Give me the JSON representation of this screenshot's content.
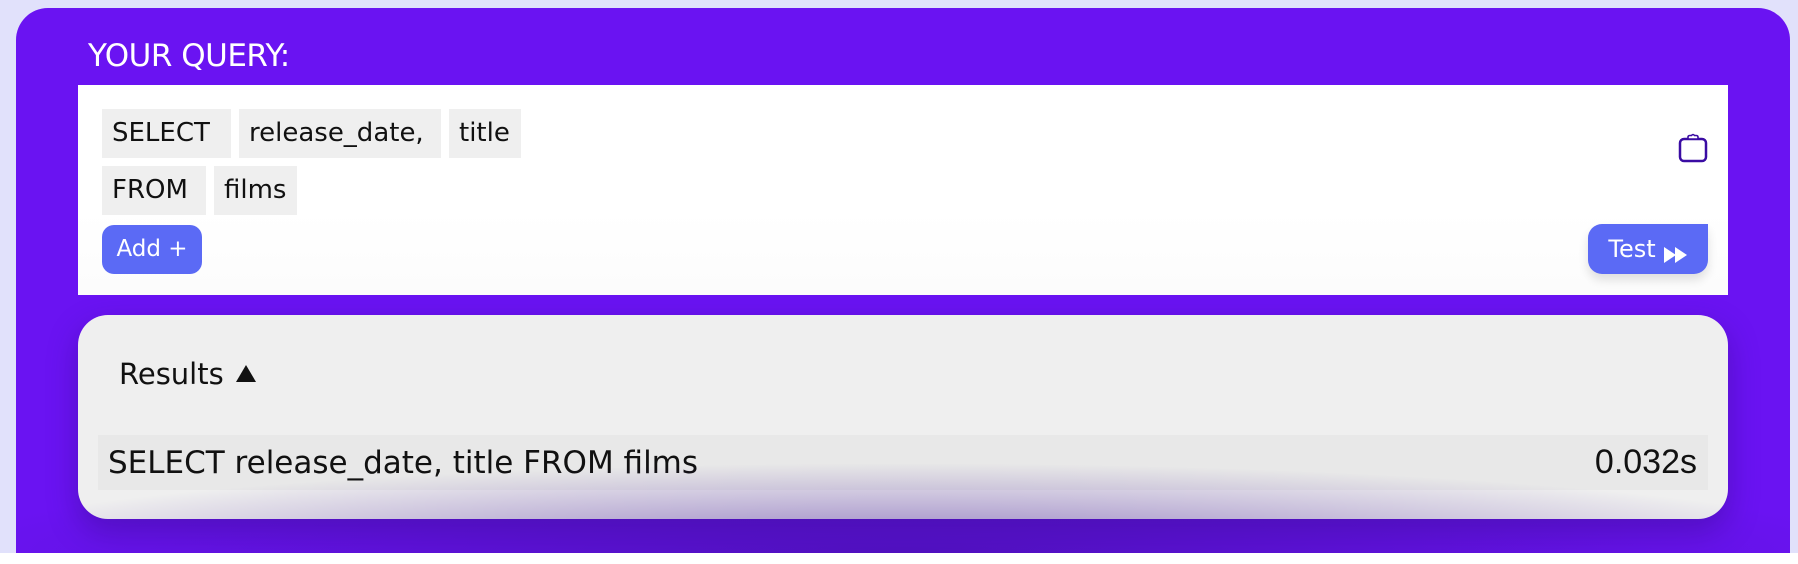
{
  "query_panel": {
    "label": "YOUR QUERY:",
    "rows": [
      [
        "SELECT",
        "release_date,",
        "title"
      ],
      [
        "FROM",
        "films"
      ]
    ],
    "add_button": "Add +",
    "test_button": "Test",
    "icons": {
      "clipboard": "clipboard-icon",
      "test": "fast-forward-icon"
    }
  },
  "results": {
    "header": "Results",
    "toggle_icon": "triangle-up-icon",
    "items": [
      {
        "query": "SELECT release_date, title FROM films",
        "time": "0.032s"
      }
    ]
  },
  "colors": {
    "panel": "#6a13f2",
    "button": "#5b6af5",
    "icon": "#3a0ca3",
    "chip": "#efefef",
    "results_bg": "#efefef",
    "row_bg": "#e8e8e8"
  }
}
